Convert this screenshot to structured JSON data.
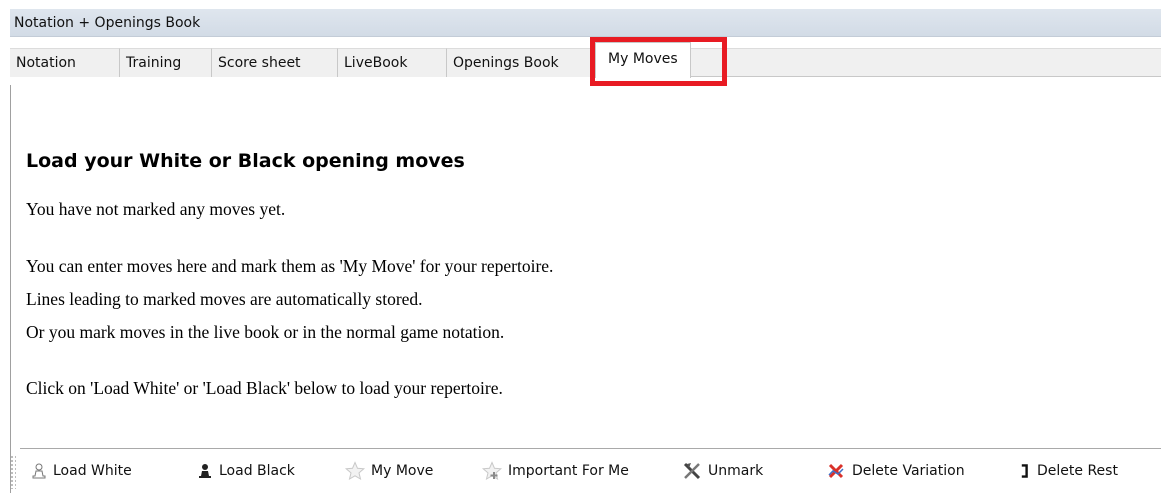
{
  "window": {
    "title": "Notation + Openings Book"
  },
  "tabs": [
    {
      "label": "Notation"
    },
    {
      "label": "Training"
    },
    {
      "label": "Score sheet"
    },
    {
      "label": "LiveBook"
    },
    {
      "label": "Openings Book"
    },
    {
      "label": "My Moves",
      "active": true
    }
  ],
  "main": {
    "heading": "Load your White or Black opening moves",
    "status": "You have not marked any moves yet.",
    "lines": [
      "You can enter moves here and mark them as 'My Move' for your repertoire.",
      "Lines leading to marked moves are automatically stored.",
      "Or you mark moves in the live book or in the normal game notation."
    ],
    "hint": "Click on 'Load White' or 'Load Black' below to load your repertoire."
  },
  "toolbar": {
    "buttons": [
      {
        "label": "Load White",
        "icon": "white-pawn-icon"
      },
      {
        "label": "Load Black",
        "icon": "black-pawn-icon"
      },
      {
        "label": "My Move",
        "icon": "star-icon"
      },
      {
        "label": "Important For Me",
        "icon": "star-plus-icon"
      },
      {
        "label": "Unmark",
        "icon": "unmark-icon"
      },
      {
        "label": "Delete Variation",
        "icon": "delete-variation-icon"
      },
      {
        "label": "Delete Rest",
        "icon": "bracket-icon"
      }
    ]
  },
  "colors": {
    "highlight": "#e81b23",
    "titlebar": "#d6dee8",
    "tabstrip": "#f0f0f0"
  }
}
